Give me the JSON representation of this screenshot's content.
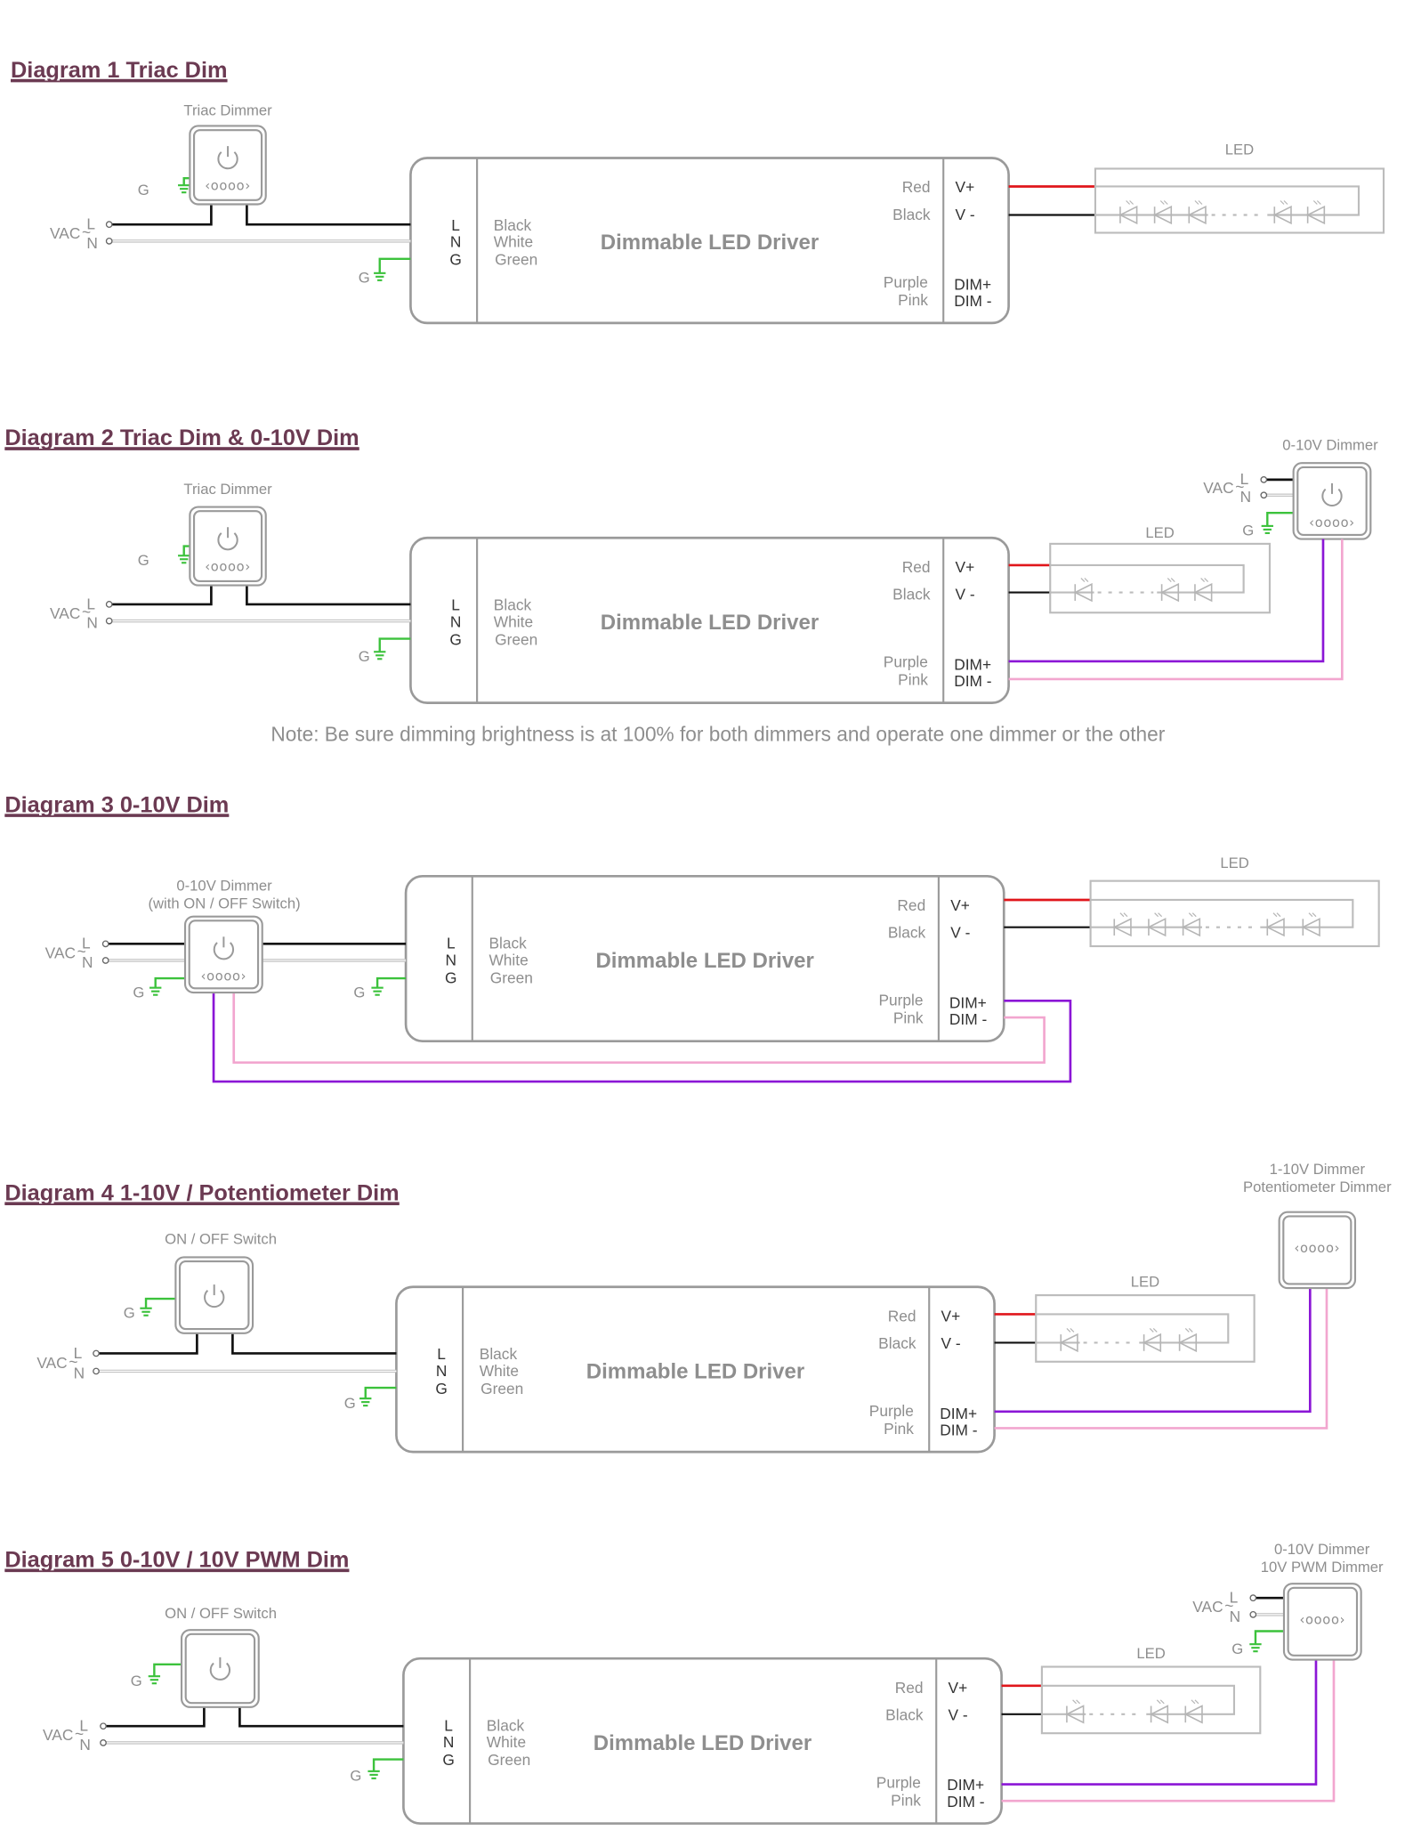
{
  "colors": {
    "title": "#6b3a52",
    "live_wire": "#111111",
    "neutral_wire": "#c4c4c4",
    "ground_wire": "#3cc23c",
    "red_wire": "#e0161b",
    "purple_wire": "#8b16d6",
    "pink_wire": "#f2a6cf",
    "outline": "#9a9a9a"
  },
  "common": {
    "driver_name": "Dimmable LED Driver",
    "input_terminals": [
      "L",
      "N",
      "G"
    ],
    "input_wire_colors": [
      "Black",
      "White",
      "Green"
    ],
    "output_wire_colors": [
      "Red",
      "Black"
    ],
    "output_terminals": [
      "V+",
      "V -"
    ],
    "dim_wire_colors": [
      "Purple",
      "Pink"
    ],
    "dim_terminals": [
      "DIM+",
      "DIM -"
    ],
    "led_label": "LED",
    "vac_label": "VAC",
    "vac_l": "L",
    "vac_n": "N",
    "tilde": "~",
    "ground_label": "G",
    "dimmer_dots": "‹oooo›"
  },
  "diagrams": [
    {
      "title": "Diagram 1  Triac Dim",
      "left_device": {
        "label": [
          "Triac Dimmer"
        ],
        "type": "power+dots"
      },
      "right_device": null
    },
    {
      "title": "Diagram 2  Triac Dim & 0-10V Dim",
      "left_device": {
        "label": [
          "Triac Dimmer"
        ],
        "type": "power+dots"
      },
      "right_device": {
        "label": [
          "0-10V Dimmer"
        ],
        "type": "power+dots"
      },
      "note": "Note: Be sure dimming brightness is at 100% for both dimmers and operate one dimmer or the other"
    },
    {
      "title": "Diagram 3  0-10V Dim",
      "left_device": {
        "label": [
          "0-10V Dimmer",
          "(with ON / OFF Switch)"
        ],
        "type": "power+dots"
      },
      "right_device": null
    },
    {
      "title": "Diagram 4  1-10V / Potentiometer  Dim",
      "left_device": {
        "label": [
          "ON / OFF Switch"
        ],
        "type": "power"
      },
      "right_device": {
        "label": [
          "1-10V Dimmer",
          "Potentiometer Dimmer"
        ],
        "type": "dots"
      }
    },
    {
      "title": "Diagram 5  0-10V / 10V PWM Dim",
      "left_device": {
        "label": [
          "ON / OFF Switch"
        ],
        "type": "power"
      },
      "right_device": {
        "label": [
          "0-10V Dimmer",
          "10V PWM Dimmer"
        ],
        "type": "dots"
      }
    }
  ]
}
